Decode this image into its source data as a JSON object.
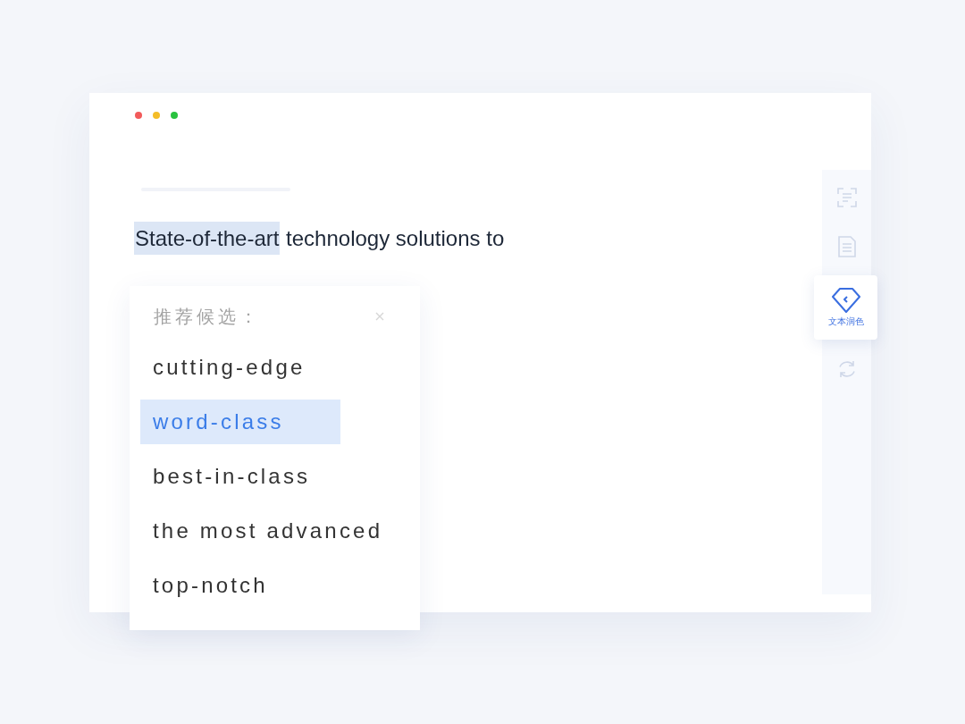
{
  "window": {
    "controls": [
      {
        "color": "#f25b5b"
      },
      {
        "color": "#f4bd28"
      },
      {
        "color": "#29c23f"
      }
    ]
  },
  "editor": {
    "segments": [
      {
        "text": "State-of-the-art",
        "highlighted": true
      },
      {
        "text": "technology solutions to",
        "highlighted": false
      }
    ]
  },
  "suggestions": {
    "title": "推荐候选：",
    "candidates": [
      {
        "text": "cutting-edge",
        "selected": false
      },
      {
        "text": "word-class",
        "selected": true
      },
      {
        "text": "best-in-class",
        "selected": false
      },
      {
        "text": "the most advanced",
        "selected": false
      },
      {
        "text": "top-notch",
        "selected": false
      }
    ]
  },
  "sidebar": {
    "tools": [
      {
        "kind": "frame",
        "selected": false
      },
      {
        "kind": "document",
        "selected": false
      },
      {
        "kind": "gem",
        "label": "文本润色",
        "selected": true
      },
      {
        "kind": "refresh",
        "selected": false
      }
    ]
  }
}
